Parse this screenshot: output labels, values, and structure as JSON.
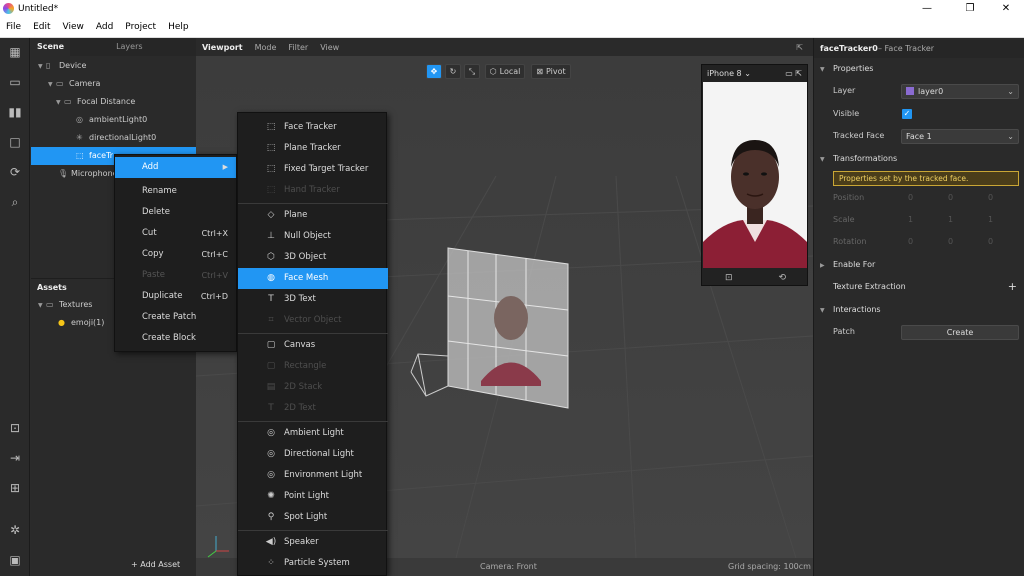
{
  "window": {
    "title": "Untitled*",
    "minimize": "—",
    "maximize": "❐",
    "close": "✕"
  },
  "menu": [
    "File",
    "Edit",
    "View",
    "Add",
    "Project",
    "Help"
  ],
  "scene_panel": {
    "tabs": [
      "Scene",
      "Layers"
    ],
    "tree": [
      {
        "label": "Device",
        "icon": "device-icon"
      },
      {
        "label": "Camera",
        "icon": "camera-icon"
      },
      {
        "label": "Focal Distance",
        "icon": "focal-distance-icon"
      },
      {
        "label": "ambientLight0",
        "icon": "ambient-light-icon"
      },
      {
        "label": "directionalLight0",
        "icon": "directional-light-icon"
      },
      {
        "label": "faceTr",
        "icon": "face-tracker-icon"
      },
      {
        "label": "Microphone",
        "icon": "microphone-icon"
      }
    ]
  },
  "assets_panel": {
    "title": "Assets",
    "folder": "Textures",
    "item": "emoji(1)",
    "add_label": "+ Add Asset"
  },
  "viewport": {
    "tabs": [
      "Viewport",
      "Mode",
      "Filter",
      "View"
    ],
    "toolbar": {
      "local": "Local",
      "pivot": "Pivot"
    },
    "device": "iPhone 8",
    "camera_label": "Camera: Front",
    "grid_label": "Grid spacing: 100cm"
  },
  "properties": {
    "title": "faceTracker0",
    "subtitle": "– Face Tracker",
    "sections": {
      "properties": "Properties",
      "transformations": "Transformations",
      "enable_for": "Enable For",
      "texture_extraction": "Texture Extraction",
      "interactions": "Interactions"
    },
    "layer_label": "Layer",
    "layer_value": "layer0",
    "layer_color": "#8a6bd1",
    "visible_label": "Visible",
    "tracked_face_label": "Tracked Face",
    "tracked_face_value": "Face 1",
    "notice": "Properties set by the tracked face.",
    "position_label": "Position",
    "position_values": [
      "0",
      "0",
      "0"
    ],
    "scale_label": "Scale",
    "scale_values": [
      "1",
      "1",
      "1"
    ],
    "rotation_label": "Rotation",
    "rotation_values": [
      "0",
      "0",
      "0"
    ],
    "add_symbol": "+",
    "patch_label": "Patch",
    "create_label": "Create"
  },
  "context_menu": [
    {
      "label": "Add",
      "shortcut": "",
      "state": "highlighted"
    },
    {
      "label": "Rename",
      "shortcut": "",
      "state": "normal"
    },
    {
      "label": "Delete",
      "shortcut": "",
      "state": "normal"
    },
    {
      "label": "Cut",
      "shortcut": "Ctrl+X",
      "state": "normal"
    },
    {
      "label": "Copy",
      "shortcut": "Ctrl+C",
      "state": "normal"
    },
    {
      "label": "Paste",
      "shortcut": "Ctrl+V",
      "state": "disabled"
    },
    {
      "label": "Duplicate",
      "shortcut": "Ctrl+D",
      "state": "normal"
    },
    {
      "label": "Create Patch",
      "shortcut": "",
      "state": "normal"
    },
    {
      "label": "Create Block",
      "shortcut": "",
      "state": "normal"
    }
  ],
  "add_submenu": [
    {
      "label": "Face Tracker",
      "icon": "face-tracker-icon",
      "state": "normal"
    },
    {
      "label": "Plane Tracker",
      "icon": "plane-tracker-icon",
      "state": "normal"
    },
    {
      "label": "Fixed Target Tracker",
      "icon": "target-tracker-icon",
      "state": "normal"
    },
    {
      "label": "Hand Tracker",
      "icon": "hand-tracker-icon",
      "state": "disabled"
    },
    {
      "label": "Plane",
      "icon": "plane-icon",
      "state": "normal"
    },
    {
      "label": "Null Object",
      "icon": "null-object-icon",
      "state": "normal"
    },
    {
      "label": "3D Object",
      "icon": "cube-icon",
      "state": "normal"
    },
    {
      "label": "Face Mesh",
      "icon": "face-mesh-icon",
      "state": "highlighted"
    },
    {
      "label": "3D Text",
      "icon": "text-icon",
      "state": "normal"
    },
    {
      "label": "Vector Object",
      "icon": "vector-icon",
      "state": "disabled"
    },
    {
      "label": "Canvas",
      "icon": "canvas-icon",
      "state": "normal"
    },
    {
      "label": "Rectangle",
      "icon": "rectangle-icon",
      "state": "disabled"
    },
    {
      "label": "2D Stack",
      "icon": "stack-icon",
      "state": "disabled"
    },
    {
      "label": "2D Text",
      "icon": "text-icon",
      "state": "disabled"
    },
    {
      "label": "Ambient Light",
      "icon": "globe-icon",
      "state": "normal"
    },
    {
      "label": "Directional Light",
      "icon": "globe-icon",
      "state": "normal"
    },
    {
      "label": "Environment Light",
      "icon": "globe-icon",
      "state": "normal"
    },
    {
      "label": "Point Light",
      "icon": "point-light-icon",
      "state": "normal"
    },
    {
      "label": "Spot Light",
      "icon": "spot-light-icon",
      "state": "normal"
    },
    {
      "label": "Speaker",
      "icon": "speaker-icon",
      "state": "normal"
    },
    {
      "label": "Particle System",
      "icon": "particle-icon",
      "state": "normal"
    }
  ]
}
